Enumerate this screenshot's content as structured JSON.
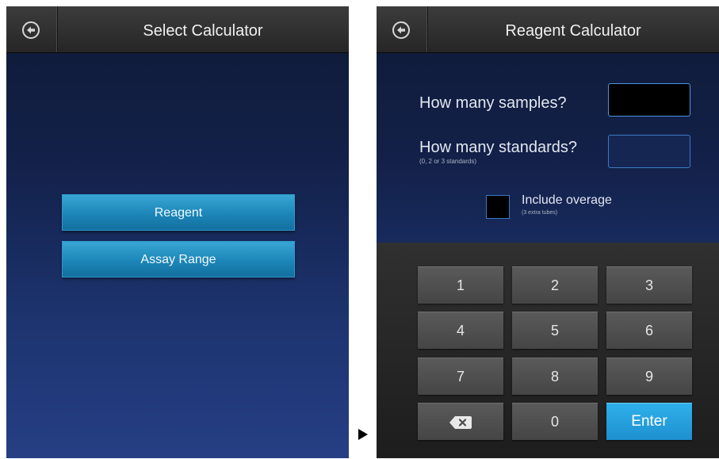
{
  "left_screen": {
    "title": "Select Calculator",
    "back_icon": "back-arrow-icon",
    "buttons": [
      "Reagent",
      "Assay Range"
    ]
  },
  "right_screen": {
    "title": "Reagent Calculator",
    "back_icon": "back-arrow-icon",
    "samples_label": "How many samples?",
    "samples_value": "",
    "standards_label": "How many standards?",
    "standards_hint": "(0, 2 or 3 standards)",
    "standards_value": "",
    "overage_label": "Include overage",
    "overage_hint": "(3 extra tubes)",
    "overage_checked": false,
    "keypad": {
      "keys": [
        "1",
        "2",
        "3",
        "4",
        "5",
        "6",
        "7",
        "8",
        "9",
        "0"
      ],
      "backspace_icon": "backspace-icon",
      "enter_label": "Enter"
    }
  },
  "colors": {
    "accent_blue": "#1d90d0",
    "button_blue": "#1c86b8",
    "background_navy": "#13214a"
  }
}
